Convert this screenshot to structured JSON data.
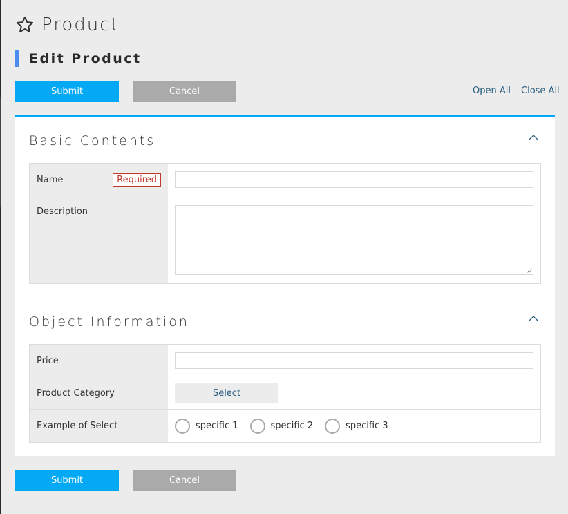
{
  "header": {
    "title": "Product",
    "title_icon": "star-icon",
    "subtitle": "Edit Product"
  },
  "toolbar": {
    "submit_label": "Submit",
    "cancel_label": "Cancel",
    "open_all_label": "Open All",
    "close_all_label": "Close All"
  },
  "sections": [
    {
      "title": "Basic Contents",
      "toggle_icon": "chevron-up-icon",
      "fields": [
        {
          "label": "Name",
          "badge": "Required",
          "type": "text",
          "value": ""
        },
        {
          "label": "Description",
          "type": "textarea",
          "value": ""
        }
      ]
    },
    {
      "title": "Object Information",
      "toggle_icon": "chevron-up-icon",
      "fields": [
        {
          "label": "Price",
          "type": "text",
          "value": ""
        },
        {
          "label": "Product Category",
          "type": "select-button",
          "button_label": "Select"
        },
        {
          "label": "Example of Select",
          "type": "radio",
          "options": [
            "specific 1",
            "specific 2",
            "specific 3"
          ],
          "selected": null
        }
      ]
    }
  ],
  "footer": {
    "submit_label": "Submit",
    "cancel_label": "Cancel"
  },
  "colors": {
    "accent": "#03a9f4",
    "subtitle_bar": "#4a8cf0",
    "cancel": "#aaaaaa",
    "required": "#c0392b",
    "link": "#2a5d80",
    "background": "#ececec"
  }
}
